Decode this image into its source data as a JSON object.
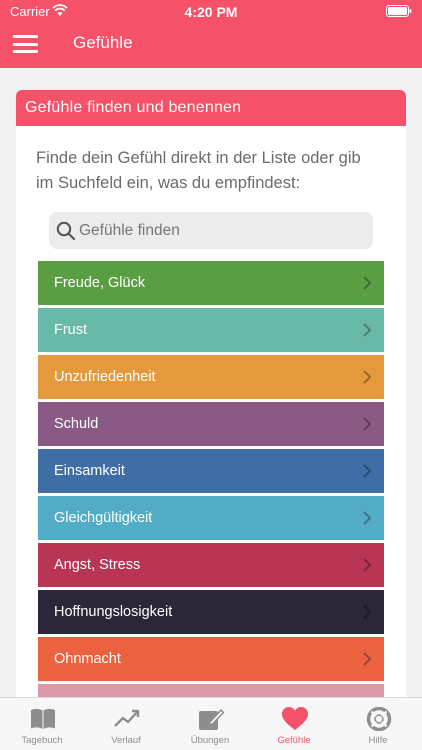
{
  "status": {
    "carrier": "Carrier",
    "time": "4:20 PM"
  },
  "header": {
    "title": "Gefühle",
    "color": "#f5526a"
  },
  "card": {
    "title": "Gefühle finden und benennen",
    "intro": "Finde dein Gefühl direkt in der Liste oder gib im Suchfeld ein, was du empfindest:"
  },
  "search": {
    "placeholder": "Gefühle finden",
    "value": ""
  },
  "emotions": [
    {
      "label": "Freude, Glück",
      "color": "#5a9e44"
    },
    {
      "label": "Frust",
      "color": "#69b9a9"
    },
    {
      "label": "Unzufriedenheit",
      "color": "#e3993c"
    },
    {
      "label": "Schuld",
      "color": "#8a5a85"
    },
    {
      "label": "Einsamkeit",
      "color": "#3f6ea7"
    },
    {
      "label": "Gleichgültigkeit",
      "color": "#52acc6"
    },
    {
      "label": "Angst, Stress",
      "color": "#b83553"
    },
    {
      "label": "Hoffnungslosigkeit",
      "color": "#2d2538"
    },
    {
      "label": "Ohnmacht",
      "color": "#ea6240"
    },
    {
      "label": "",
      "color": "#dc9aa9"
    }
  ],
  "tabs": [
    {
      "label": "Tagebuch",
      "icon": "book-icon",
      "active": false
    },
    {
      "label": "Verlauf",
      "icon": "trend-icon",
      "active": false
    },
    {
      "label": "Übungen",
      "icon": "edit-icon",
      "active": false
    },
    {
      "label": "Gefühle",
      "icon": "heart-icon",
      "active": true
    },
    {
      "label": "Hilfe",
      "icon": "lifebuoy-icon",
      "active": false
    }
  ]
}
